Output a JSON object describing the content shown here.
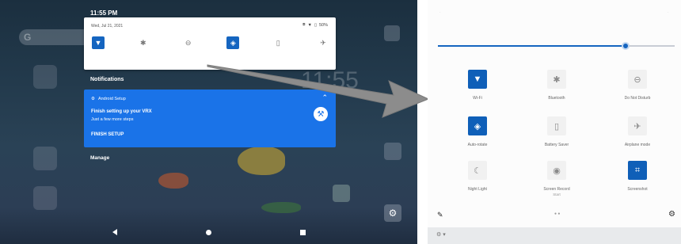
{
  "tablet": {
    "status_time": "11:55 PM",
    "quick_panel": {
      "date": "Wed, Jul 21, 2021",
      "battery": "50%",
      "tiles": [
        {
          "icon": "wifi-icon",
          "on": true
        },
        {
          "icon": "bluetooth-icon",
          "on": false
        },
        {
          "icon": "do-not-disturb-icon",
          "on": false
        },
        {
          "icon": "auto-rotate-icon",
          "on": true
        },
        {
          "icon": "battery-saver-icon",
          "on": false
        },
        {
          "icon": "airplane-mode-icon",
          "on": false
        }
      ]
    },
    "notifications_heading": "Notifications",
    "notification": {
      "app": "Android Setup",
      "title": "Finish setting up your VRX",
      "subtitle": "Just a few more steps",
      "action": "FINISH SETUP"
    },
    "manage_label": "Manage"
  },
  "expanded_qs": {
    "brightness_level": 0.8,
    "tiles": [
      {
        "label": "Wi-Fi",
        "sub": "",
        "icon": "wifi-icon",
        "on": true
      },
      {
        "label": "Bluetooth",
        "sub": "",
        "icon": "bluetooth-icon",
        "on": false
      },
      {
        "label": "Do Not Disturb",
        "sub": "",
        "icon": "do-not-disturb-icon",
        "on": false
      },
      {
        "label": "Auto-rotate",
        "sub": "",
        "icon": "auto-rotate-icon",
        "on": true
      },
      {
        "label": "Battery Saver",
        "sub": "",
        "icon": "battery-saver-icon",
        "on": false
      },
      {
        "label": "Airplane mode",
        "sub": "",
        "icon": "airplane-mode-icon",
        "on": false
      },
      {
        "label": "Night Light",
        "sub": "",
        "icon": "night-light-icon",
        "on": false
      },
      {
        "label": "Screen Record",
        "sub": "Start",
        "icon": "screen-record-icon",
        "on": false
      },
      {
        "label": "Screenshot",
        "sub": "",
        "icon": "screenshot-icon",
        "on": true
      }
    ],
    "accent_color": "#0f5fb8"
  }
}
